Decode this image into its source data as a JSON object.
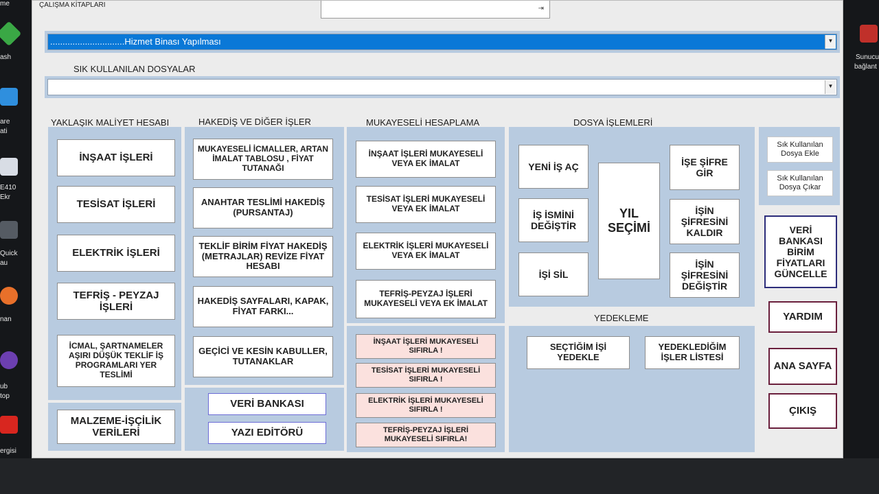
{
  "window": {
    "title": "ÇALIŞMA KİTAPLARI"
  },
  "project_combo": {
    "value": "..............................Hizmet Binası Yapılması"
  },
  "frequent": {
    "label": "SIK KULLANILAN DOSYALAR",
    "value": ""
  },
  "sections": {
    "maliyet": "YAKLAŞIK MALİYET HESABI",
    "hakedis": "HAKEDİŞ VE DİĞER İŞLER",
    "mukayeseli": "MUKAYESELİ HESAPLAMA",
    "dosya": "DOSYA İŞLEMLERİ",
    "yedekleme": "YEDEKLEME"
  },
  "maliyet_buttons": {
    "insaat": "İNŞAAT İŞLERİ",
    "tesisat": "TESİSAT İŞLERİ",
    "elektrik": "ELEKTRİK İŞLERİ",
    "tefris": "TEFRİŞ - PEYZAJ İŞLERİ",
    "icmal": "İCMAL, ŞARTNAMELER AŞIRI DÜŞÜK TEKLİF İŞ PROGRAMLARI YER TESLİMİ",
    "malzeme": "MALZEME-İŞÇİLİK VERİLERİ"
  },
  "hakedis_buttons": {
    "mukayeseli_icmaller": "MUKAYESELİ İCMALLER, ARTAN İMALAT TABLOSU , FİYAT TUTANAĞI",
    "anahtar": "ANAHTAR TESLİMİ HAKEDİŞ (PURSANTAJ)",
    "teklif": "TEKLİF BİRİM FİYAT HAKEDİŞ (METRAJLAR) REVİZE FİYAT HESABI",
    "sayfalar": "HAKEDİŞ SAYFALARI, KAPAK, FİYAT FARKI...",
    "kabuller": "GEÇİCİ VE KESİN KABULLER, TUTANAKLAR",
    "veri_bankasi": "VERİ BANKASI",
    "yazi_editoru": "YAZI EDİTÖRÜ"
  },
  "mukayeseli_buttons": {
    "insaat": "İNŞAAT İŞLERİ MUKAYESELİ VEYA EK İMALAT",
    "tesisat": "TESİSAT İŞLERİ MUKAYESELİ VEYA EK İMALAT",
    "elektrik": "ELEKTRİK İŞLERİ MUKAYESELİ VEYA EK İMALAT",
    "tefris": "TEFRİŞ-PEYZAJ İŞLERİ MUKAYESELİ VEYA EK İMALAT",
    "insaat_sifirla": "İNŞAAT İŞLERİ MUKAYESELİ SIFIRLA !",
    "tesisat_sifirla": "TESİSAT İŞLERİ MUKAYESELİ SIFIRLA !",
    "elektrik_sifirla": "ELEKTRİK İŞLERİ MUKAYESELİ SIFIRLA !",
    "tefris_sifirla": "TEFRİŞ-PEYZAJ İŞLERİ MUKAYESELİ SIFIRLA!"
  },
  "dosya_buttons": {
    "yeni_is": "YENİ İŞ AÇ",
    "is_ismini": "İŞ İSMİNİ DEĞİŞTİR",
    "isi_sil": "İŞİ SİL",
    "yil_secimi": "YIL SEÇİMİ",
    "ise_sifre": "İŞE ŞİFRE GİR",
    "sifre_kaldir": "İŞİN ŞİFRESİNİ KALDIR",
    "sifre_degistir": "İŞİN ŞİFRESİNİ DEĞİŞTİR"
  },
  "yedekleme_buttons": {
    "yedekle": "SEÇTİĞİM İŞİ YEDEKLE",
    "liste": "YEDEKLEDİĞİM İŞLER LİSTESİ"
  },
  "side_buttons": {
    "sik_ekle": "Sık Kullanılan Dosya Ekle",
    "sik_cikar": "Sık Kullanılan Dosya Çıkar",
    "veri_bankasi_guncelle": "VERİ BANKASI BİRİM FİYATLARI GÜNCELLE",
    "yardim": "YARDIM",
    "ana_sayfa": "ANA SAYFA",
    "cikis": "ÇIKIŞ"
  },
  "desktop_labels": {
    "l1": "me",
    "l2": "ash",
    "l3": "are",
    "l4": "ati",
    "l5": "E410",
    "l6": "Ekr",
    "l7": "Quick",
    "l8": "au",
    "l9": "nan",
    "l10": "ub",
    "l11": "top",
    "l12": "ergisi",
    "r1": "Sunucu",
    "r2": "bağlant"
  },
  "colors": {
    "panel": "#b8cbe0",
    "selection": "#0a78d7",
    "reset_button": "#fbe1de",
    "outline": "#2c2c7a"
  }
}
